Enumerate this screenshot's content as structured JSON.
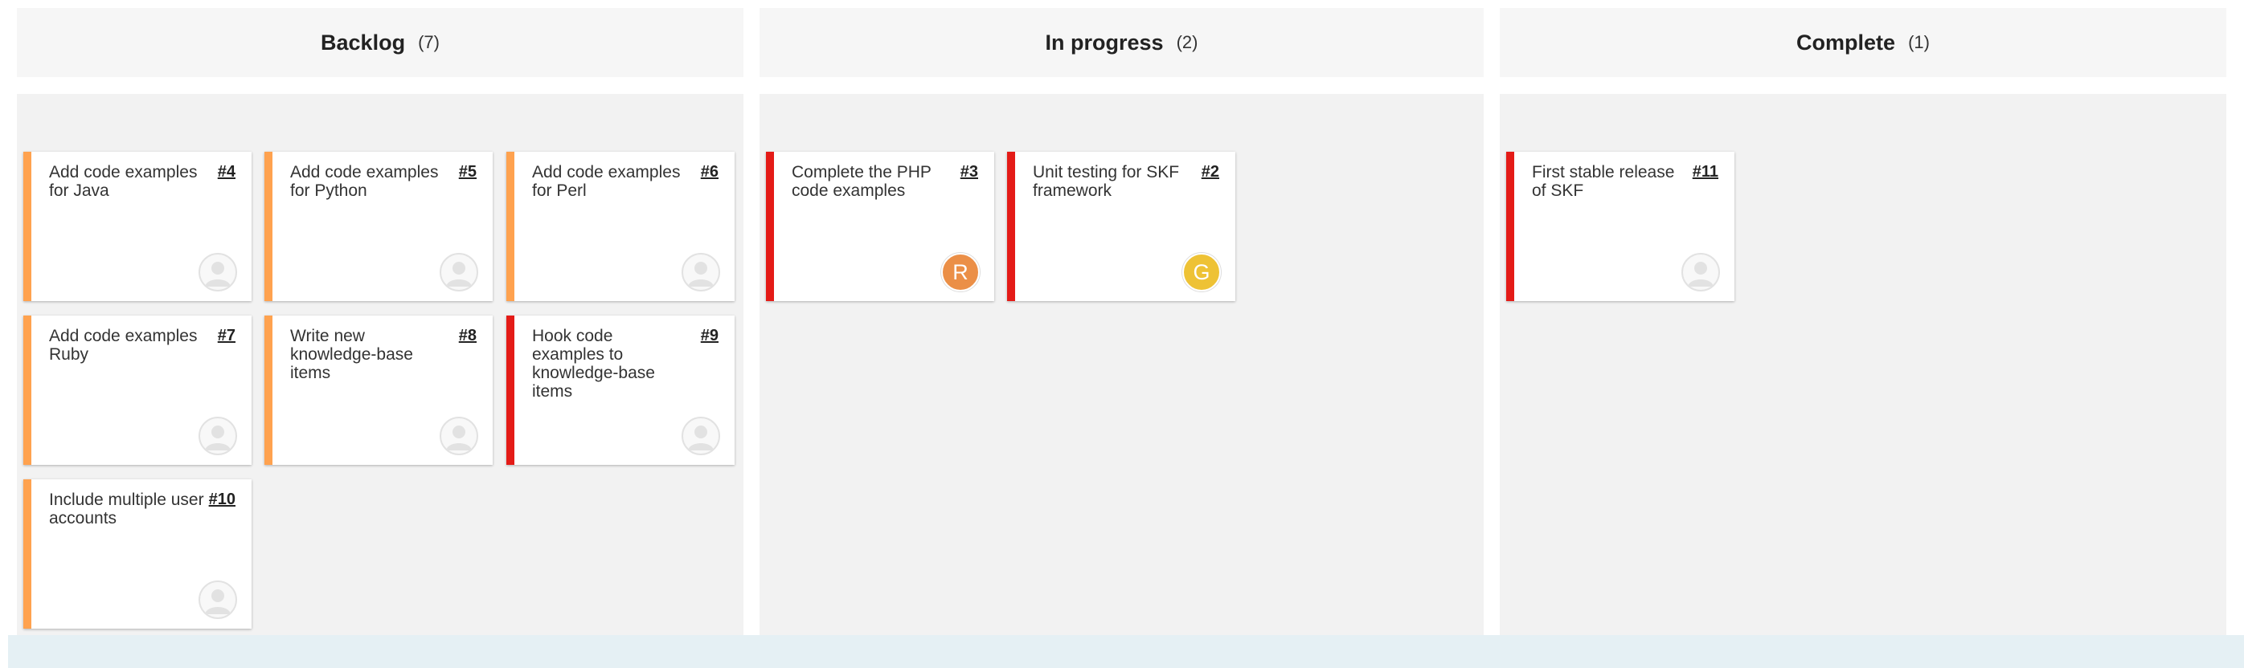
{
  "colors": {
    "header_bg": "#f6f6f6",
    "column_bg": "#f2f2f2",
    "priority_medium": "#ffa24f",
    "priority_high": "#e41b17",
    "avatar_R": "#eb8f47",
    "avatar_G": "#eec235",
    "bottom_bar": "#e5f0f4"
  },
  "columns": [
    {
      "title": "Backlog",
      "count": "(7)",
      "cards": [
        {
          "title": "Add code examples for Java",
          "issue": "#4",
          "priority": "medium",
          "avatar": "empty-user-icon"
        },
        {
          "title": "Add code examples for Python",
          "issue": "#5",
          "priority": "medium",
          "avatar": "empty-user-icon"
        },
        {
          "title": "Add code examples for Perl",
          "issue": "#6",
          "priority": "medium",
          "avatar": "empty-user-icon"
        },
        {
          "title": "Add code examples Ruby",
          "issue": "#7",
          "priority": "medium",
          "avatar": "empty-user-icon"
        },
        {
          "title": "Write new knowledge-base items",
          "issue": "#8",
          "priority": "medium",
          "avatar": "empty-user-icon"
        },
        {
          "title": "Hook code examples to knowledge-base items",
          "issue": "#9",
          "priority": "high",
          "avatar": "empty-user-icon"
        },
        {
          "title": "Include multiple user accounts",
          "issue": "#10",
          "priority": "medium",
          "avatar": "empty-user-icon"
        }
      ]
    },
    {
      "title": "In progress",
      "count": "(2)",
      "cards": [
        {
          "title": "Complete the PHP code examples",
          "issue": "#3",
          "priority": "high",
          "avatar_initial": "R"
        },
        {
          "title": "Unit testing for SKF framework",
          "issue": "#2",
          "priority": "high",
          "avatar_initial": "G"
        }
      ]
    },
    {
      "title": "Complete",
      "count": "(1)",
      "cards": [
        {
          "title": "First stable release of SKF",
          "issue": "#11",
          "priority": "high",
          "avatar": "empty-user-icon"
        }
      ]
    }
  ]
}
